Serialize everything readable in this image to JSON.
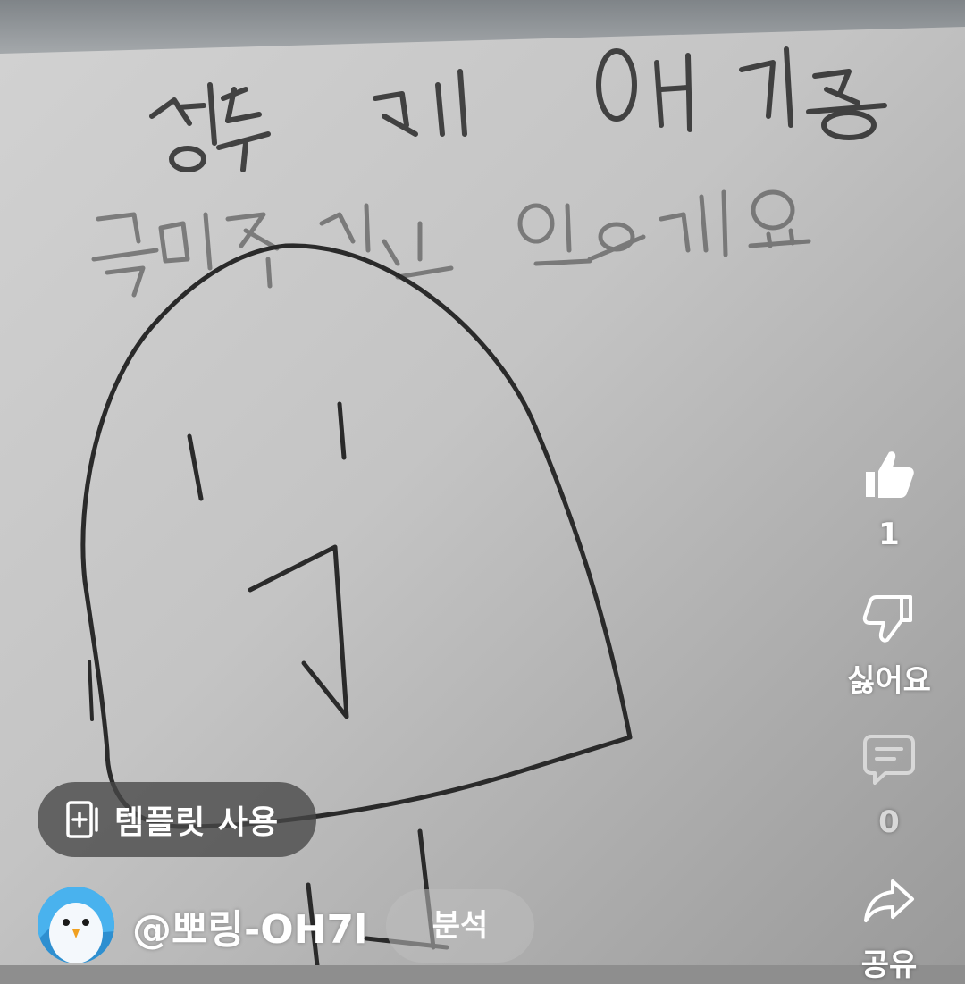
{
  "actions": {
    "like": {
      "icon": "thumbs-up-icon",
      "count": "1"
    },
    "dislike": {
      "icon": "thumbs-down-icon",
      "label": "싫어요"
    },
    "comment": {
      "icon": "comment-icon",
      "count": "0"
    },
    "share": {
      "icon": "share-arrow-icon",
      "label": "공유"
    }
  },
  "template": {
    "icon": "add-template-icon",
    "label": "템플릿 사용"
  },
  "channel": {
    "handle": "@뽀링-OH7l",
    "analytics_label": "분석"
  },
  "colors": {
    "overlay_text": "#ffffff",
    "pill_background": "#464646",
    "ink": "#1e1e1e"
  }
}
